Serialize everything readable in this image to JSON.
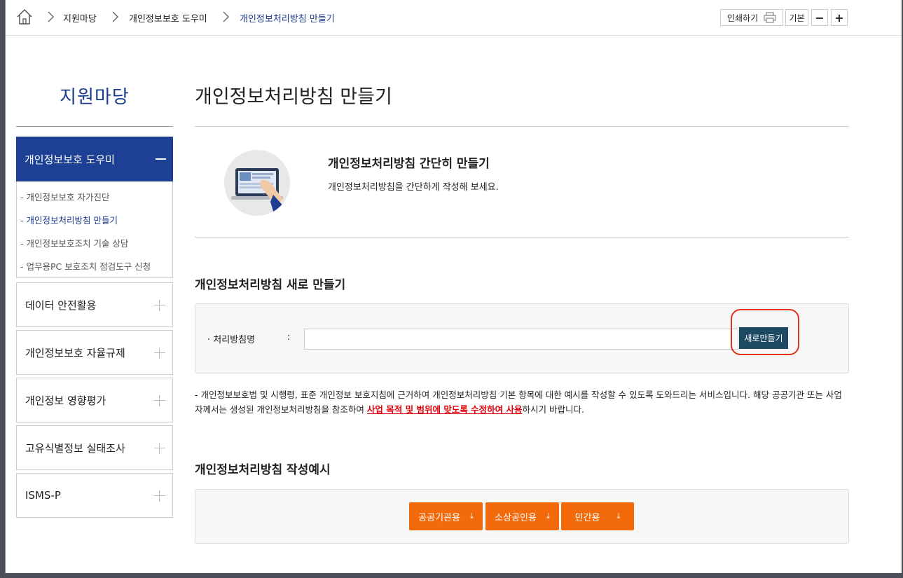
{
  "breadcrumb": {
    "home_label": "home",
    "items": [
      "지원마당",
      "개인정보보호 도우미",
      "개인정보처리방침 만들기"
    ]
  },
  "toolbar": {
    "print_label": "인쇄하기",
    "default_label": "기본",
    "zoom_out_label": "−",
    "zoom_in_label": "+"
  },
  "sidebar": {
    "title": "지원마당",
    "active_section": "개인정보보호 도우미",
    "sub_items": [
      "- 개인정보보호 자가진단",
      "- 개인정보처리방침 만들기",
      "- 개인정보보호조치 기술 상담",
      "- 업무용PC 보호조치 점검도구 신청"
    ],
    "sections": [
      "데이터 안전활용",
      "개인정보보호 자율규제",
      "개인정보 영향평가",
      "고유식별정보 실태조사",
      "ISMS-P"
    ]
  },
  "main": {
    "page_title": "개인정보처리방침 만들기",
    "intro_title": "개인정보처리방침 간단히 만들기",
    "intro_sub": "개인정보처리방침을 간단하게 작성해 보세요.",
    "new_section_title": "개인정보처리방침 새로 만들기",
    "form_label": "·  처리방침명",
    "form_colon": ":",
    "form_value": "",
    "new_button": "새로만들기",
    "notice_part1": "- 개인정보보호법 및 시행령, 표준 개인정보 보호지침에 근거하여 개인정보처리방침 기본 항목에 대한 예시를 작성할 수 있도록 도와드리는 서비스입니다. 해당 공공기관 또는 사업자께서는 생성된 개인정보처리방침을 참조하여 ",
    "notice_highlight": "사업 목적 및 범위에 맞도록 수정하여 사용",
    "notice_part2": "하시기 바랍니다.",
    "example_section_title": "개인정보처리방침 작성예시",
    "download_buttons": [
      "공공기관용",
      "소상공인용",
      "민간용"
    ]
  },
  "colors": {
    "brand_blue": "#1d4094",
    "button_dark": "#1e4a63",
    "orange": "#f26a0a",
    "highlight_red": "#e0000b",
    "ring_red": "#e0341e"
  }
}
